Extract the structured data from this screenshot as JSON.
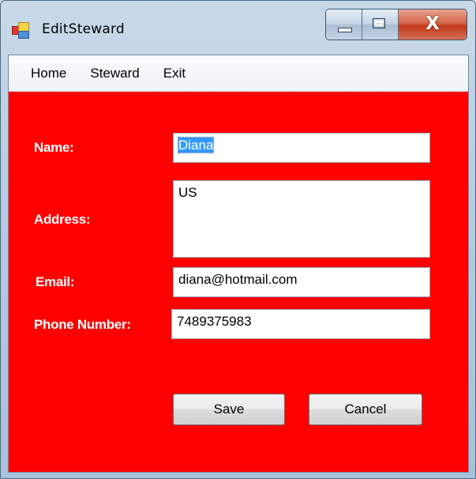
{
  "window": {
    "title": "EditSteward",
    "controls": {
      "minimize_icon": "minimize-icon",
      "maximize_icon": "maximize-icon",
      "close_icon": "close-icon",
      "close_glyph": "X"
    }
  },
  "menu": {
    "items": [
      {
        "label": "Home"
      },
      {
        "label": "Steward"
      },
      {
        "label": "Exit"
      }
    ]
  },
  "form": {
    "name": {
      "label": "Name:",
      "value": "Diana"
    },
    "address": {
      "label": "Address:",
      "value": "US"
    },
    "email": {
      "label": "Email:",
      "value": "diana@hotmail.com"
    },
    "phone": {
      "label": "Phone Number:",
      "value": "7489375983"
    }
  },
  "actions": {
    "save_label": "Save",
    "cancel_label": "Cancel"
  },
  "colors": {
    "form_background": "#ff0000",
    "label_text": "#ffffff",
    "selection": "#3399ff"
  }
}
